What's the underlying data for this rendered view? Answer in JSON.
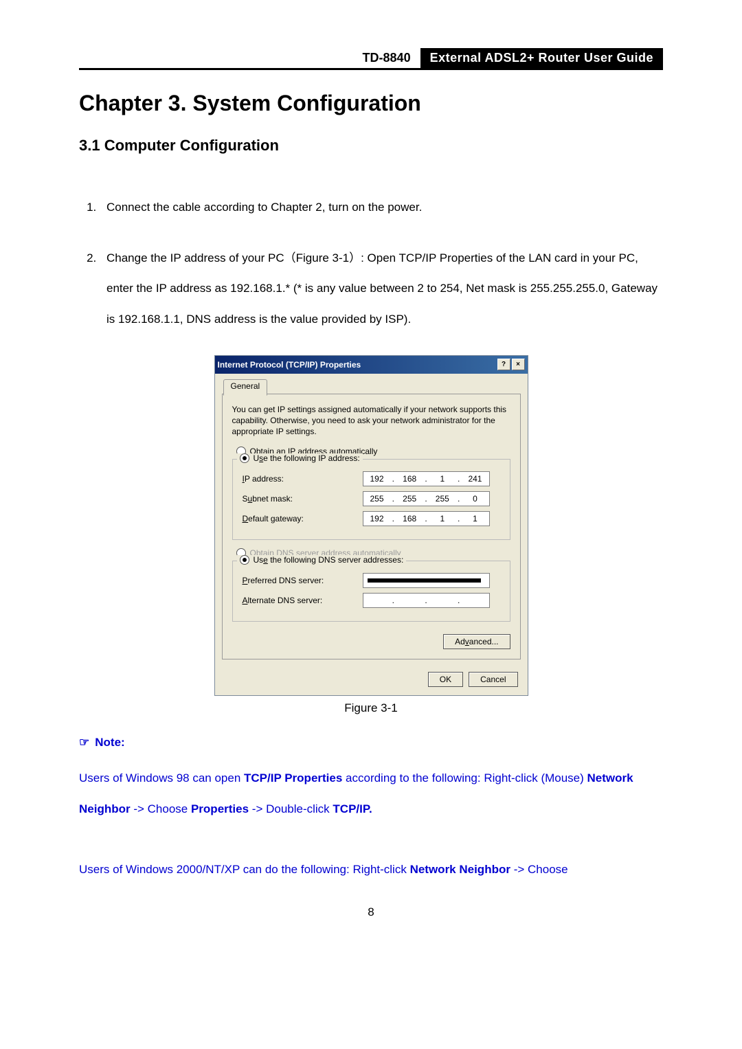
{
  "header": {
    "model": "TD-8840",
    "title": "External  ADSL2+  Router  User  Guide"
  },
  "chapter_title": "Chapter 3. System Configuration",
  "section_title": "3.1   Computer Configuration",
  "steps": [
    "Connect the cable according to Chapter 2, turn on the power.",
    "Change the IP address of your PC（Figure 3-1）: Open TCP/IP Properties of the LAN card in your PC, enter the IP address as 192.168.1.* (* is any value between 2 to 254, Net mask is 255.255.255.0, Gateway is 192.168.1.1, DNS address is the value provided by ISP)."
  ],
  "dialog": {
    "title": "Internet Protocol (TCP/IP) Properties",
    "help_btn": "?",
    "close_btn": "×",
    "tab": "General",
    "desc": "You can get IP settings assigned automatically if your network supports this capability. Otherwise, you need to ask your network administrator for the appropriate IP settings.",
    "radio_obtain_ip": "Obtain an IP address automatically",
    "radio_use_ip": "Use the following IP address:",
    "ip_label": "IP address:",
    "ip_value": [
      "192",
      "168",
      "1",
      "241"
    ],
    "subnet_label": "Subnet mask:",
    "subnet_value": [
      "255",
      "255",
      "255",
      "0"
    ],
    "gateway_label": "Default gateway:",
    "gateway_value": [
      "192",
      "168",
      "1",
      "1"
    ],
    "radio_obtain_dns": "Obtain DNS server address automatically",
    "radio_use_dns": "Use the following DNS server addresses:",
    "pref_dns_label": "Preferred DNS server:",
    "alt_dns_label": "Alternate DNS server:",
    "advanced_btn": "Advanced...",
    "ok_btn": "OK",
    "cancel_btn": "Cancel"
  },
  "figure_caption": "Figure 3-1",
  "note": {
    "label": "Note:",
    "line1a": "Users of Windows 98 can open ",
    "line1b": "TCP/IP Properties",
    "line1c": " according to the following: Right-click (Mouse) ",
    "line2a": "Network Neighbor",
    "line2b": " -> Choose ",
    "line2c": "Properties",
    "line2d": " -> Double-click ",
    "line2e": "TCP/IP.",
    "line3a": "Users of Windows 2000/NT/XP can do the following: Right-click ",
    "line3b": "Network Neighbor",
    "line3c": " -> Choose"
  },
  "page_number": "8"
}
